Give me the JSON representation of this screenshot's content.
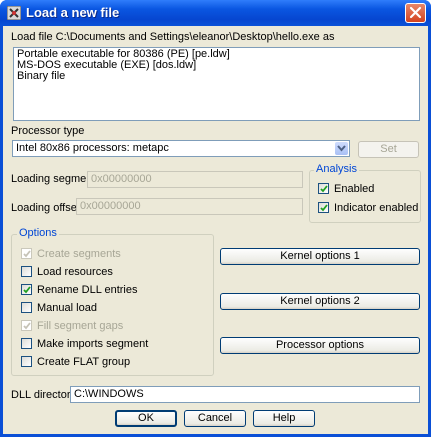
{
  "window": {
    "title": "Load a new file"
  },
  "load_file_label": "Load file C:\\Documents and Settings\\eleanor\\Desktop\\hello.exe as",
  "file_types": [
    "Portable executable for 80386 (PE) [pe.ldw]",
    "MS-DOS executable (EXE) [dos.ldw]",
    "Binary file"
  ],
  "processor": {
    "label": "Processor type",
    "value": "Intel 80x86 processors: metapc",
    "set_label": "Set"
  },
  "loading_segment": {
    "label": "Loading segment",
    "value": "0x00000000"
  },
  "loading_offset": {
    "label": "Loading offset",
    "value": "0x00000000"
  },
  "analysis": {
    "title": "Analysis",
    "enabled_label": "Enabled",
    "enabled_checked": true,
    "indicator_label": "Indicator enabled",
    "indicator_checked": true
  },
  "options": {
    "title": "Options",
    "items": [
      {
        "label": "Create segments",
        "checked": true,
        "disabled": true
      },
      {
        "label": "Load resources",
        "checked": false,
        "disabled": false
      },
      {
        "label": "Rename DLL entries",
        "checked": true,
        "disabled": false
      },
      {
        "label": "Manual load",
        "checked": false,
        "disabled": false
      },
      {
        "label": "Fill segment gaps",
        "checked": true,
        "disabled": true
      },
      {
        "label": "Make imports segment",
        "checked": false,
        "disabled": false
      },
      {
        "label": "Create FLAT group",
        "checked": false,
        "disabled": false
      }
    ]
  },
  "buttons": {
    "kernel1": "Kernel options 1",
    "kernel2": "Kernel options 2",
    "processor_options": "Processor options",
    "ok": "OK",
    "cancel": "Cancel",
    "help": "Help"
  },
  "dll_directory": {
    "label": "DLL directory",
    "value": "C:\\WINDOWS"
  },
  "colors": {
    "titlebar": "#0a56e1",
    "dialog_bg": "#ece9d8",
    "group_label": "#0046d5",
    "close": "#d5431f"
  }
}
